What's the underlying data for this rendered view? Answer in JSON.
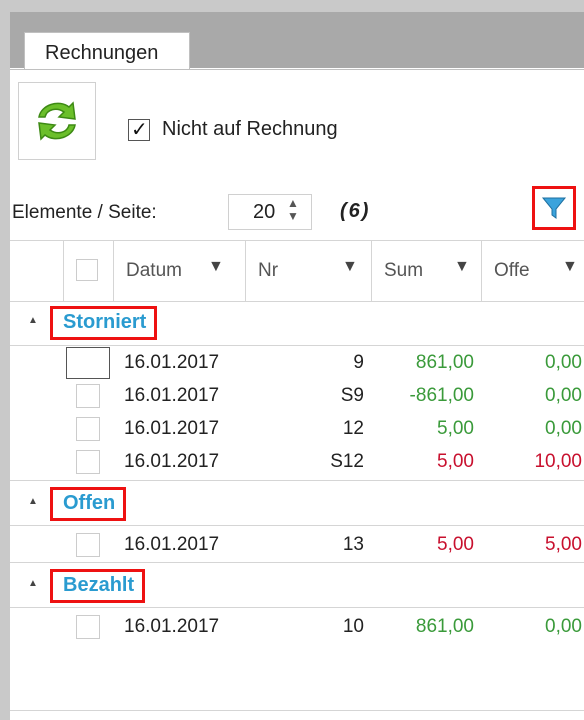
{
  "tabs": [
    {
      "label": "Rechnungen"
    }
  ],
  "toolbar": {
    "refresh_icon": "refresh-icon",
    "checkbox_label": "Nicht auf Rechnung",
    "checkbox_checked": true
  },
  "pager": {
    "label": "Elemente / Seite:",
    "page_size": "20",
    "count": "(6)"
  },
  "filter_icon": "funnel-icon",
  "columns": [
    {
      "label": "Datum"
    },
    {
      "label": "Nr"
    },
    {
      "label": "Sum"
    },
    {
      "label": "Offe"
    }
  ],
  "groups": [
    {
      "name": "Storniert",
      "rows": [
        {
          "datum": "16.01.2017",
          "nr": "9",
          "sum": "861,00",
          "offen": "0,00",
          "sum_color": "green",
          "offen_color": "green"
        },
        {
          "datum": "16.01.2017",
          "nr": "S9",
          "sum": "-861,00",
          "offen": "0,00",
          "sum_color": "green",
          "offen_color": "green"
        },
        {
          "datum": "16.01.2017",
          "nr": "12",
          "sum": "5,00",
          "offen": "0,00",
          "sum_color": "green",
          "offen_color": "green"
        },
        {
          "datum": "16.01.2017",
          "nr": "S12",
          "sum": "5,00",
          "offen": "10,00",
          "sum_color": "red",
          "offen_color": "red"
        }
      ]
    },
    {
      "name": "Offen",
      "rows": [
        {
          "datum": "16.01.2017",
          "nr": "13",
          "sum": "5,00",
          "offen": "5,00",
          "sum_color": "red",
          "offen_color": "red"
        }
      ]
    },
    {
      "name": "Bezahlt",
      "rows": [
        {
          "datum": "16.01.2017",
          "nr": "10",
          "sum": "861,00",
          "offen": "0,00",
          "sum_color": "green",
          "offen_color": "green"
        }
      ]
    }
  ],
  "colors": {
    "accent_blue": "#2a9bd0",
    "green": "#3a9a3a",
    "red": "#c8102e",
    "highlight": "#e11111"
  }
}
